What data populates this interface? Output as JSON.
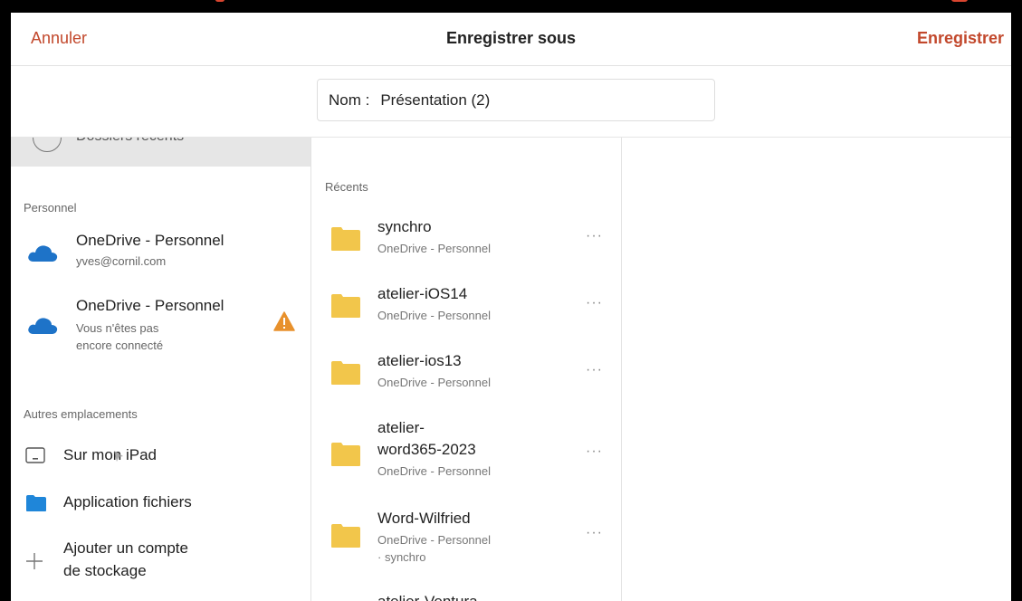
{
  "header": {
    "cancel_label": "Annuler",
    "title": "Enregistrer sous",
    "save_label": "Enregistrer"
  },
  "name_field": {
    "label": "Nom :",
    "value": "Présentation (2)"
  },
  "sidebar": {
    "recent_item": "Dossiers récents",
    "personal_section": "Personnel",
    "accounts": [
      {
        "name": "OneDrive - Personnel",
        "sub": "yves@cornil.com",
        "icon": "onedrive-cloud-icon"
      },
      {
        "name": "OneDrive - Personnel",
        "sub_line1": "Vous n'êtes pas",
        "sub_line2": "encore connecté",
        "icon": "onedrive-cloud-icon",
        "warning_icon": "warning-icon"
      }
    ],
    "other_section": "Autres emplacements",
    "locations": [
      {
        "label": "Sur mon iPad",
        "icon": "ipad-icon"
      },
      {
        "label": "Application fichiers",
        "icon": "folder-blue-icon"
      },
      {
        "label_line1": "Ajouter un compte",
        "label_line2": "de stockage",
        "icon": "plus-icon"
      }
    ]
  },
  "list": {
    "section": "Récents",
    "folders": [
      {
        "name": "synchro",
        "location": "OneDrive - Personnel"
      },
      {
        "name": "atelier-iOS14",
        "location": "OneDrive - Personnel"
      },
      {
        "name": "atelier-ios13",
        "location": "OneDrive - Personnel"
      },
      {
        "name_line1": "atelier-",
        "name_line2": "word365-2023",
        "location": "OneDrive - Personnel"
      },
      {
        "name": "Word-Wilfried",
        "location": "OneDrive - Personnel",
        "location_line2": "· synchro"
      },
      {
        "name": "atelier-Ventura"
      }
    ],
    "more_label": "···"
  },
  "colors": {
    "accent": "#c2482c",
    "folder": "#f2c64b",
    "onedrive": "#1e73c8",
    "warning": "#e8912c",
    "selected_row": "#e6e6e6"
  }
}
